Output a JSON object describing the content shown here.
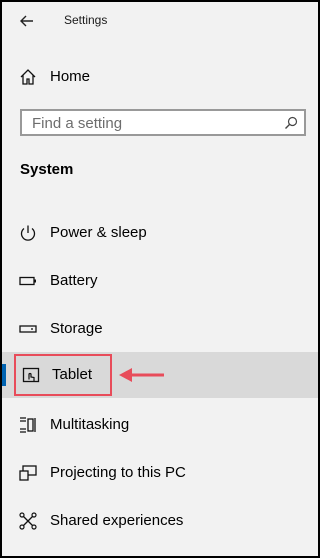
{
  "window": {
    "title": "Settings"
  },
  "nav": {
    "home_label": "Home",
    "search_placeholder": "Find a setting",
    "section_title": "System",
    "items": [
      {
        "label": "Power & sleep",
        "icon": "power-icon"
      },
      {
        "label": "Battery",
        "icon": "battery-icon"
      },
      {
        "label": "Storage",
        "icon": "storage-icon"
      },
      {
        "label": "Tablet",
        "icon": "tablet-icon",
        "selected": true
      },
      {
        "label": "Multitasking",
        "icon": "multitasking-icon"
      },
      {
        "label": "Projecting to this PC",
        "icon": "projecting-icon"
      },
      {
        "label": "Shared experiences",
        "icon": "shared-experiences-icon"
      }
    ]
  },
  "colors": {
    "accent": "#0063b1",
    "annotation": "#e84c5a",
    "selected_bg": "#d9d9d9",
    "panel_bg": "#f2f2f2"
  }
}
